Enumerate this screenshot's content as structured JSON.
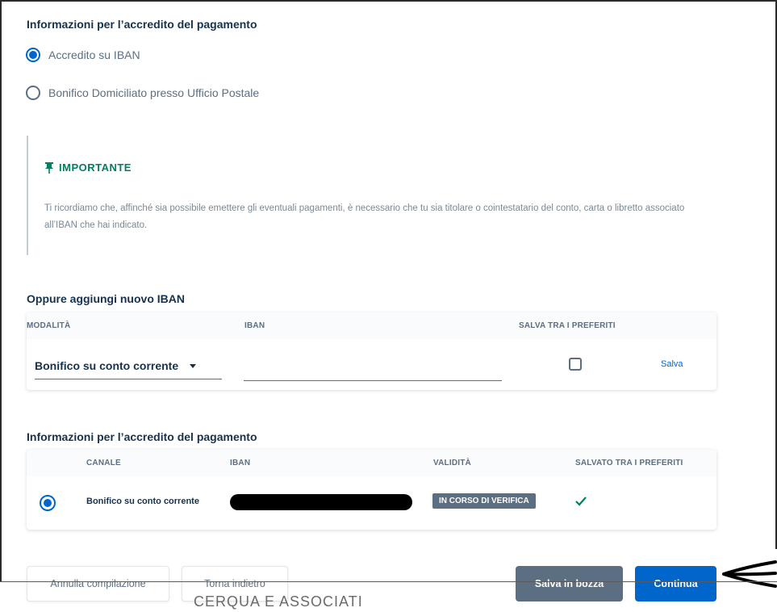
{
  "payment_section": {
    "title": "Informazioni per l’accredito del pagamento",
    "options": [
      {
        "label": "Accredito su IBAN",
        "selected": true
      },
      {
        "label": "Bonifico Domiciliato presso Ufficio Postale",
        "selected": false
      }
    ]
  },
  "notice": {
    "title": "IMPORTANTE",
    "text": "Ti ricordiamo che, affinché sia possibile emettere gli eventuali pagamenti, è necessario che tu sia titolare o cointestatario del conto, carta o libretto associato all’IBAN che hai indicato."
  },
  "new_iban": {
    "title": "Oppure aggiungi nuovo IBAN",
    "headers": {
      "mode": "MODALITÀ",
      "iban": "IBAN",
      "favorites": "SALVA TRA I PREFERITI"
    },
    "mode_value": "Bonifico su conto corrente",
    "iban_value": "",
    "save_favorite": false,
    "save_link": "Salva"
  },
  "saved_section": {
    "title": "Informazioni per l’accredito del pagamento",
    "headers": {
      "channel": "CANALE",
      "iban": "IBAN",
      "validity": "VALIDITÀ",
      "saved": "SALVATO TRA I PREFERITI"
    },
    "rows": [
      {
        "selected": true,
        "channel": "Bonifico su conto corrente",
        "iban": "[redacted]",
        "validity": "IN CORSO DI VERIFICA",
        "saved": true
      }
    ]
  },
  "actions": {
    "cancel": "Annulla compilazione",
    "back": "Torna indietro",
    "draft": "Salva in bozza",
    "continue": "Continua"
  },
  "footer_fragment": "CERQUA E ASSOCIATI",
  "colors": {
    "primary": "#0066cc",
    "secondary": "#5c6f82",
    "accent": "#00805f",
    "text": "#17324d"
  }
}
